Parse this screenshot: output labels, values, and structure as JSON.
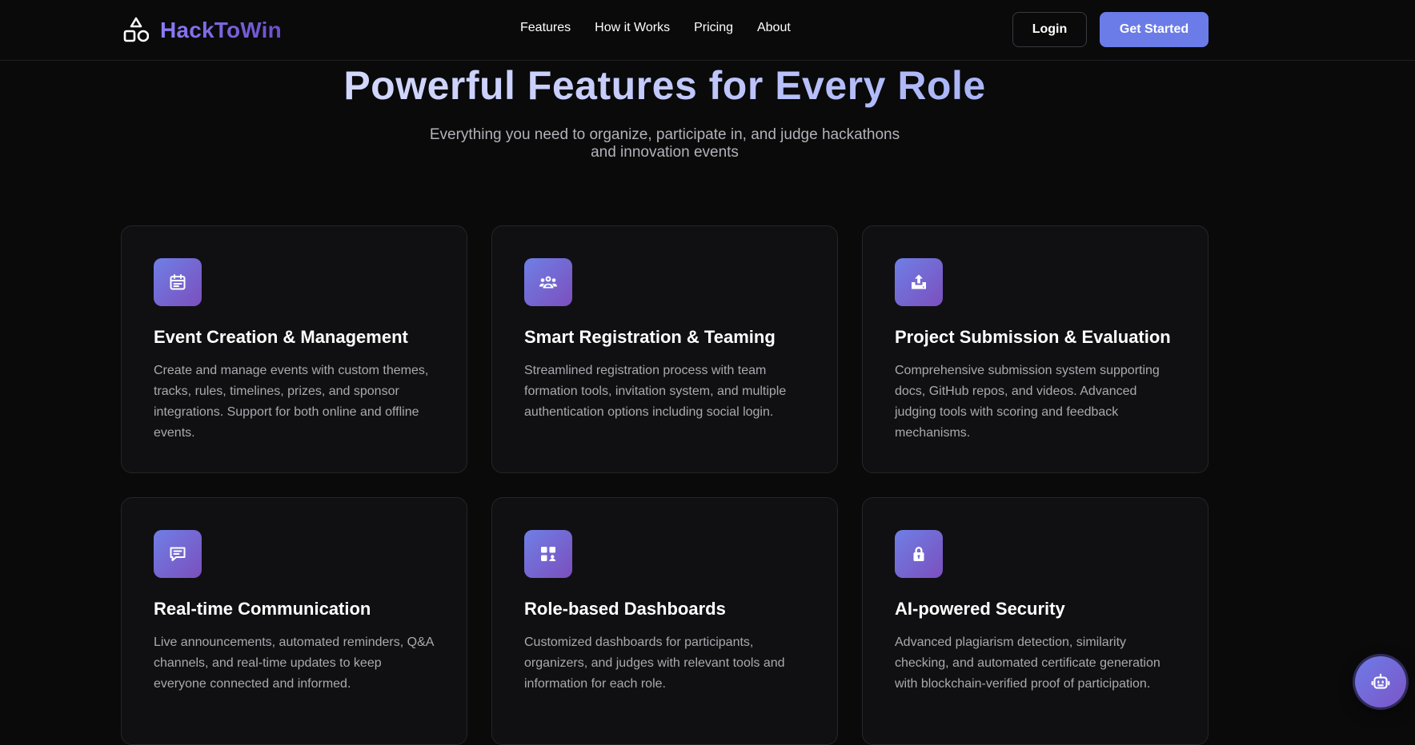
{
  "header": {
    "brand": "HackToWin",
    "nav": [
      "Features",
      "How it Works",
      "Pricing",
      "About"
    ],
    "login_label": "Login",
    "cta_label": "Get Started"
  },
  "hero": {
    "title": "Powerful Features for Every Role",
    "subtitle_line1": "Everything you need to organize, participate in, and judge hackathons",
    "subtitle_line2": "and innovation events"
  },
  "colors": {
    "accent": "#6b7ce8",
    "accent_purple": "#7b4fbd",
    "background": "#0a0a0b",
    "card": "#101012"
  },
  "features": [
    {
      "icon": "calendar-icon",
      "title": "Event Creation & Management",
      "description": "Create and manage events with custom themes, tracks, rules, timelines, prizes, and sponsor integrations. Support for both online and offline events."
    },
    {
      "icon": "team-icon",
      "title": "Smart Registration & Teaming",
      "description": "Streamlined registration process with team formation tools, invitation system, and multiple authentication options including social login."
    },
    {
      "icon": "upload-icon",
      "title": "Project Submission & Evaluation",
      "description": "Comprehensive submission system supporting docs, GitHub repos, and videos. Advanced judging tools with scoring and feedback mechanisms."
    },
    {
      "icon": "chat-icon",
      "title": "Real-time Communication",
      "description": "Live announcements, automated reminders, Q&A channels, and real-time updates to keep everyone connected and informed."
    },
    {
      "icon": "dashboard-icon",
      "title": "Role-based Dashboards",
      "description": "Customized dashboards for participants, organizers, and judges with relevant tools and information for each role."
    },
    {
      "icon": "lock-icon",
      "title": "AI-powered Security",
      "description": "Advanced plagiarism detection, similarity checking, and automated certificate generation with blockchain-verified proof of participation."
    }
  ],
  "chatbot": {
    "icon": "robot-icon"
  }
}
